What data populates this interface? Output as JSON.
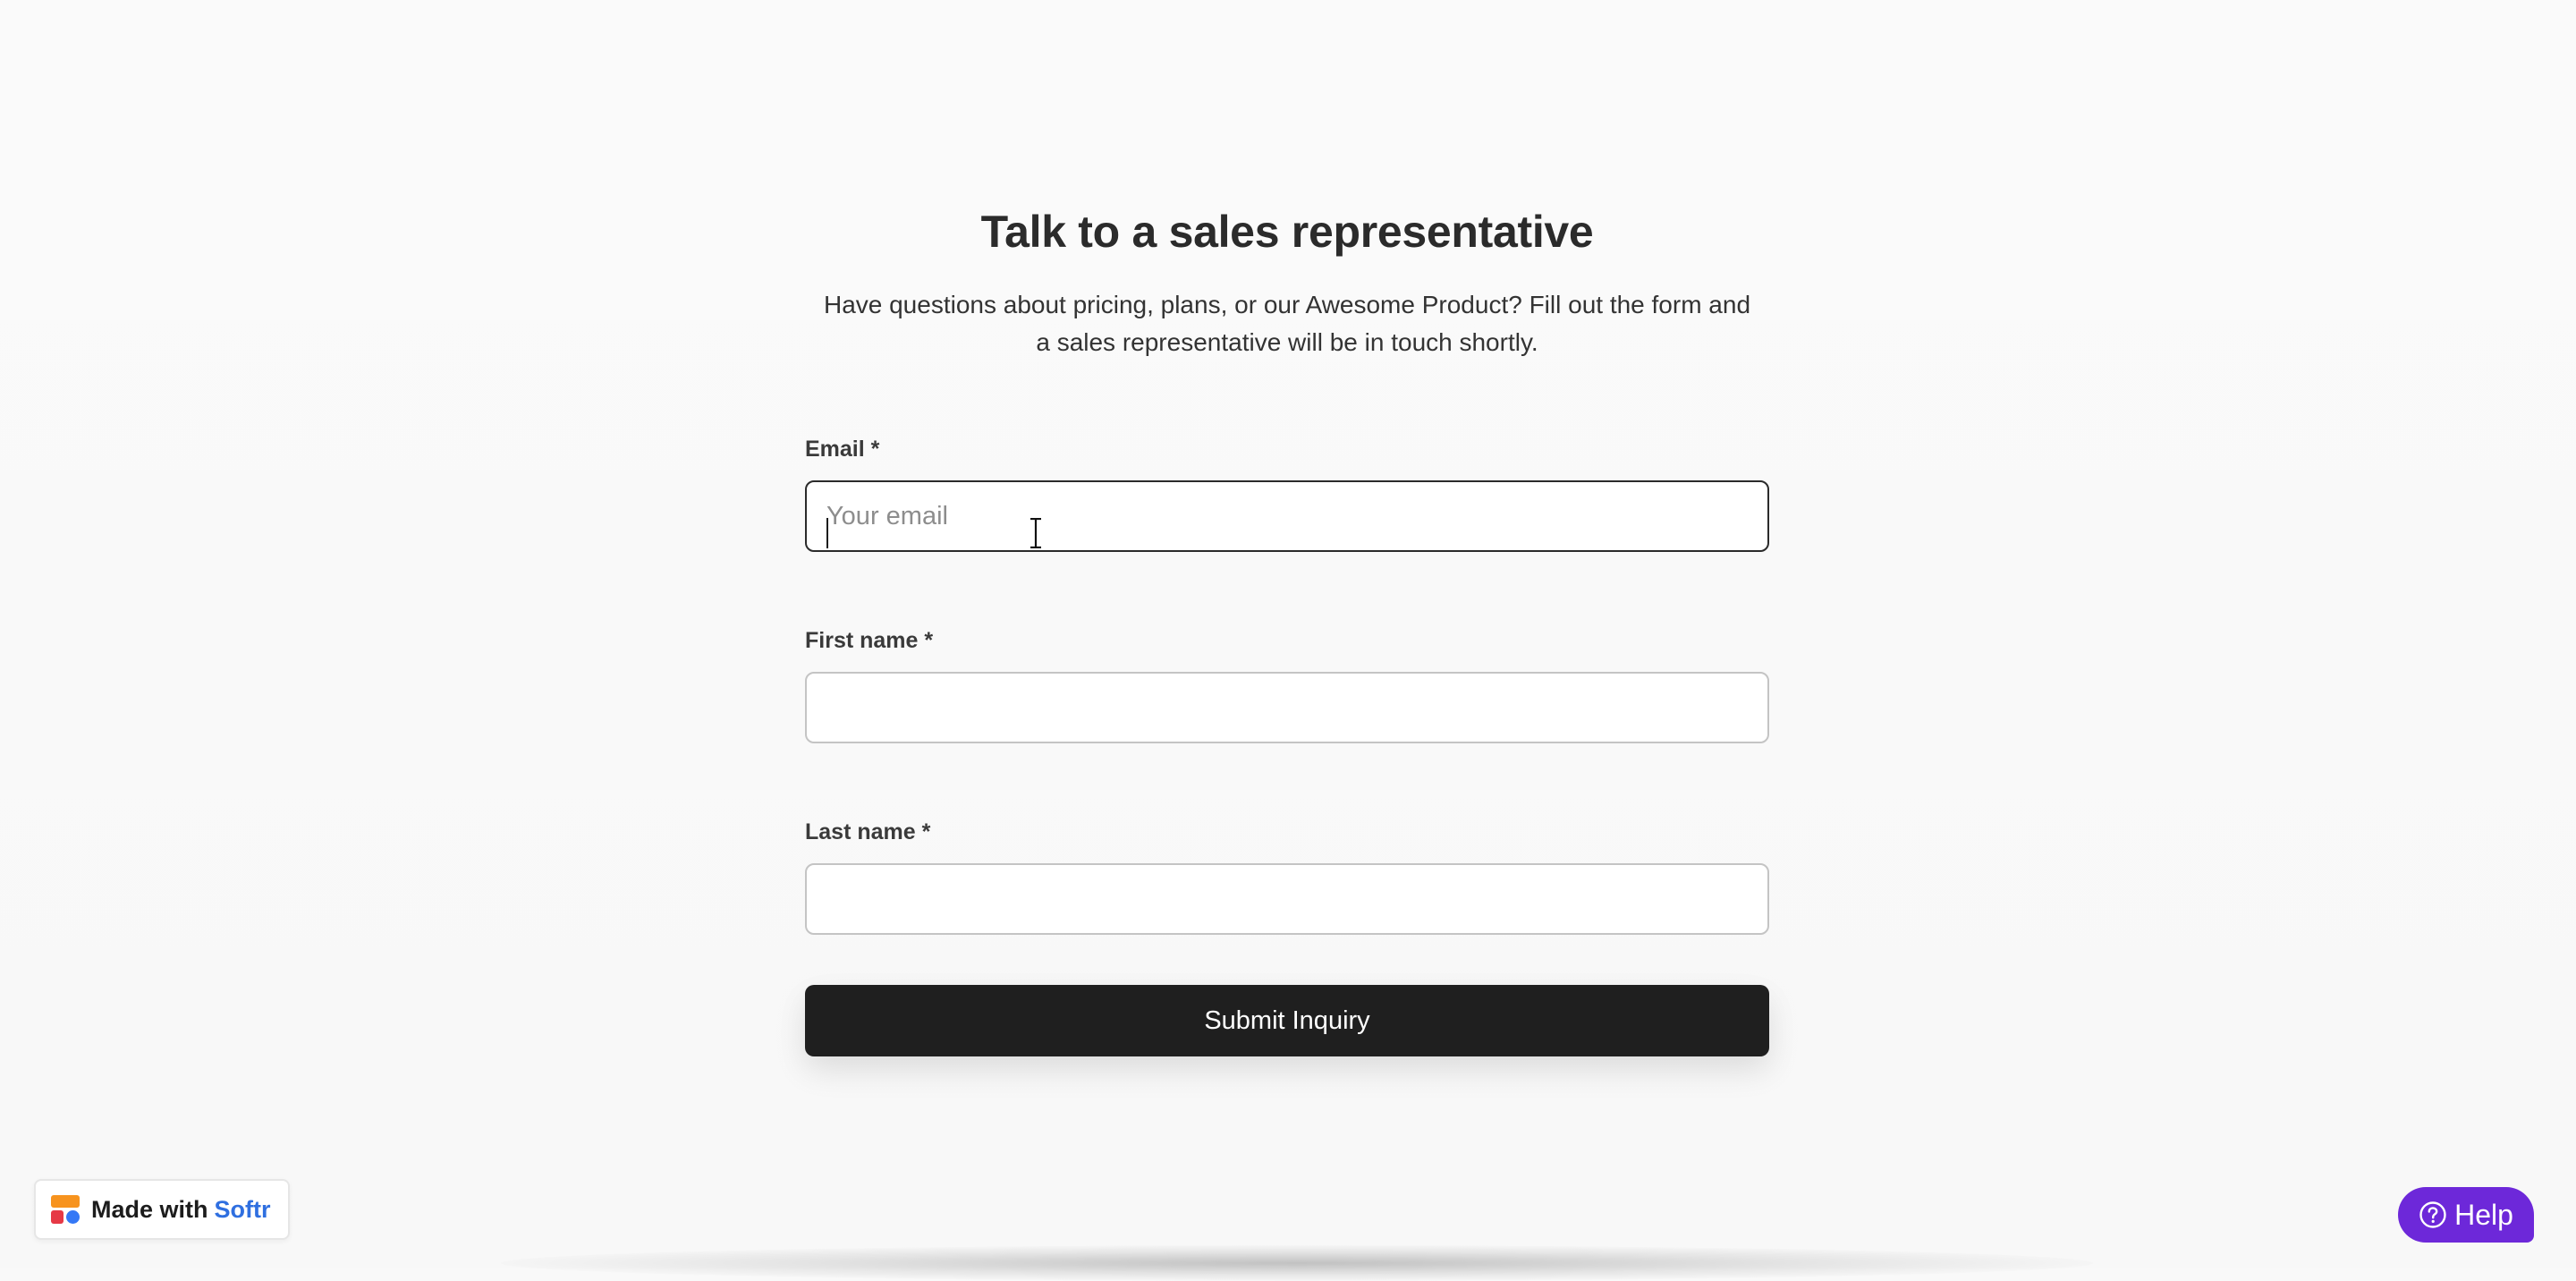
{
  "header": {
    "title": "Talk to a sales representative",
    "subtitle": "Have questions about pricing, plans, or our Awesome Product? Fill out the form and a sales representative will be in touch shortly."
  },
  "form": {
    "email": {
      "label": "Email *",
      "placeholder": "Your email",
      "value": ""
    },
    "first_name": {
      "label": "First name *",
      "placeholder": "",
      "value": ""
    },
    "last_name": {
      "label": "Last name *",
      "placeholder": "",
      "value": ""
    },
    "submit_label": "Submit Inquiry"
  },
  "badge": {
    "prefix": "Made with",
    "brand": "Softr",
    "logo_icon": "softr-logo-icon"
  },
  "help": {
    "label": "Help",
    "icon": "question-circle-icon"
  },
  "colors": {
    "background": "#f9f9f9",
    "submit_bg": "#1f1f1f",
    "help_bg": "#6d28d9",
    "brand_blue": "#2f6fe0"
  }
}
